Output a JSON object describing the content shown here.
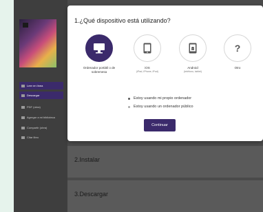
{
  "sidebar": {
    "items": [
      {
        "label": "Leer en línea",
        "active": true
      },
      {
        "label": "Descargar",
        "active": true
      },
      {
        "label": "PDF (obra)",
        "active": false
      },
      {
        "label": "Agregar a mi biblioteca",
        "active": false
      },
      {
        "label": "Compartir (obra)",
        "active": false
      },
      {
        "label": "Citar libro",
        "active": false
      }
    ]
  },
  "modal": {
    "title": "1.¿Qué dispositivo está utilizando?",
    "options": [
      {
        "label": "Ordenador portátil o de sobremesa",
        "sub": "",
        "icon": "monitor-icon",
        "selected": true
      },
      {
        "label": "iOS",
        "sub": "(iPad, iPhone, iPod)",
        "icon": "ios-device-icon",
        "selected": false
      },
      {
        "label": "Android",
        "sub": "(teléfono, tablet)",
        "icon": "android-device-icon",
        "selected": false
      },
      {
        "label": "Otro",
        "sub": "",
        "icon": "question-icon",
        "selected": false
      }
    ],
    "radios": [
      {
        "label": "Estoy usando mi propio ordenador",
        "checked": true
      },
      {
        "label": "Estoy usando un ordenador público",
        "checked": false
      }
    ],
    "continue_label": "Continuar"
  },
  "steps": {
    "install_title": "2.Instalar",
    "download_title": "3.Descargar"
  },
  "colors": {
    "accent": "#3b2a6b"
  }
}
